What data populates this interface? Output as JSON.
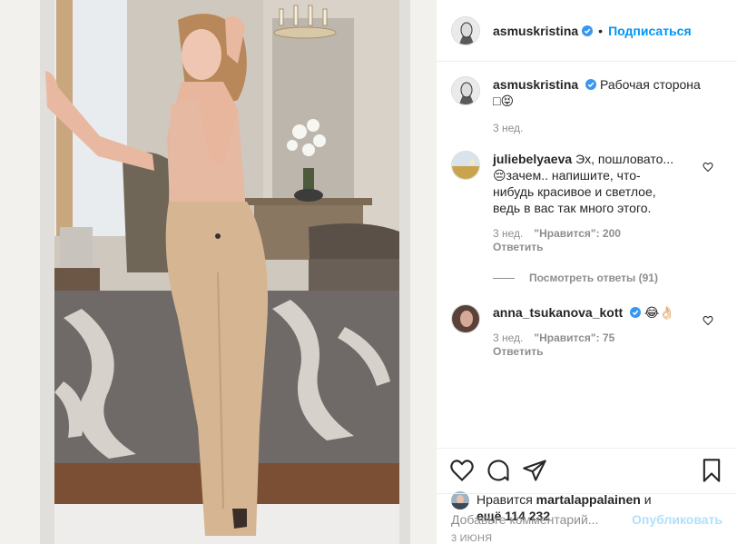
{
  "post": {
    "author": "asmuskristina",
    "follow_label": "Подписаться",
    "separator": "•",
    "caption_author": "asmuskristina",
    "caption_text": "Рабочая сторона",
    "caption_emoji": "□😝",
    "caption_time": "3 нед."
  },
  "comments": [
    {
      "author": "juliebelyaeva",
      "text_line1": "Эх, пошловато...",
      "text_line2": "😔зачем.. напишите, что-",
      "text_line3": "нибудь красивое и светлое,",
      "text_line4": "ведь в вас так много этого.",
      "time": "3 нед.",
      "likes": "\"Нравится\": 200",
      "reply_label": "Ответить",
      "view_replies": "Посмотреть ответы (91)"
    },
    {
      "author": "anna_tsukanova_kott",
      "text": "😂👌🏻",
      "time": "3 нед.",
      "likes": "\"Нравится\": 75",
      "reply_label": "Ответить"
    }
  ],
  "likes_block": {
    "prefix": "Нравится",
    "user": "martalappalainen",
    "and": "и",
    "others": "ещё 114 232"
  },
  "date": "3 ИЮНЯ",
  "add_comment": {
    "placeholder": "Добавьте комментарий...",
    "publish_label": "Опубликовать"
  },
  "colors": {
    "accent": "#0095f6",
    "publish_disabled": "#b2dffc",
    "muted": "#8e8e8e",
    "text": "#262626"
  },
  "icons": [
    "verified-badge-icon",
    "heart-icon",
    "comment-icon",
    "share-icon",
    "bookmark-icon"
  ]
}
